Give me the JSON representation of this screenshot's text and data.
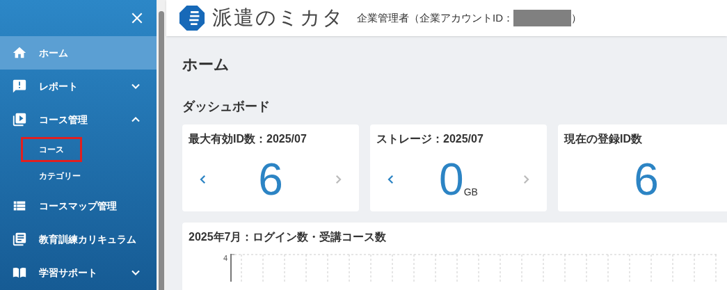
{
  "sidebar": {
    "items": [
      {
        "label": "ホーム",
        "selected": true
      },
      {
        "label": "レポート",
        "selected": false,
        "expanded": false
      },
      {
        "label": "コース管理",
        "selected": false,
        "expanded": true,
        "children": [
          {
            "label": "コース",
            "highlighted": true
          },
          {
            "label": "カテゴリー",
            "highlighted": false
          }
        ]
      },
      {
        "label": "コースマップ管理",
        "selected": false
      },
      {
        "label": "教育訓練カリキュラム",
        "selected": false
      },
      {
        "label": "学習サポート",
        "selected": false,
        "expanded": false
      }
    ]
  },
  "header": {
    "brand": "派遣のミカタ",
    "role": "企業管理者（企業アカウントID：",
    "id_redacted": true,
    "role_end": "）"
  },
  "page_title": "ホーム",
  "section_title": "ダッシュボード",
  "cards": [
    {
      "title": "最大有効ID数：2025/07",
      "value": "6",
      "prev_enabled": true,
      "next_enabled": false
    },
    {
      "title": "ストレージ：2025/07",
      "value": "0",
      "unit": "GB",
      "prev_enabled": true,
      "next_enabled": false
    },
    {
      "title": "現在の登録ID数",
      "value": "6"
    }
  ],
  "chart": {
    "title": "2025年7月：ログイン数・受講コース数",
    "y_tick": "4"
  }
}
